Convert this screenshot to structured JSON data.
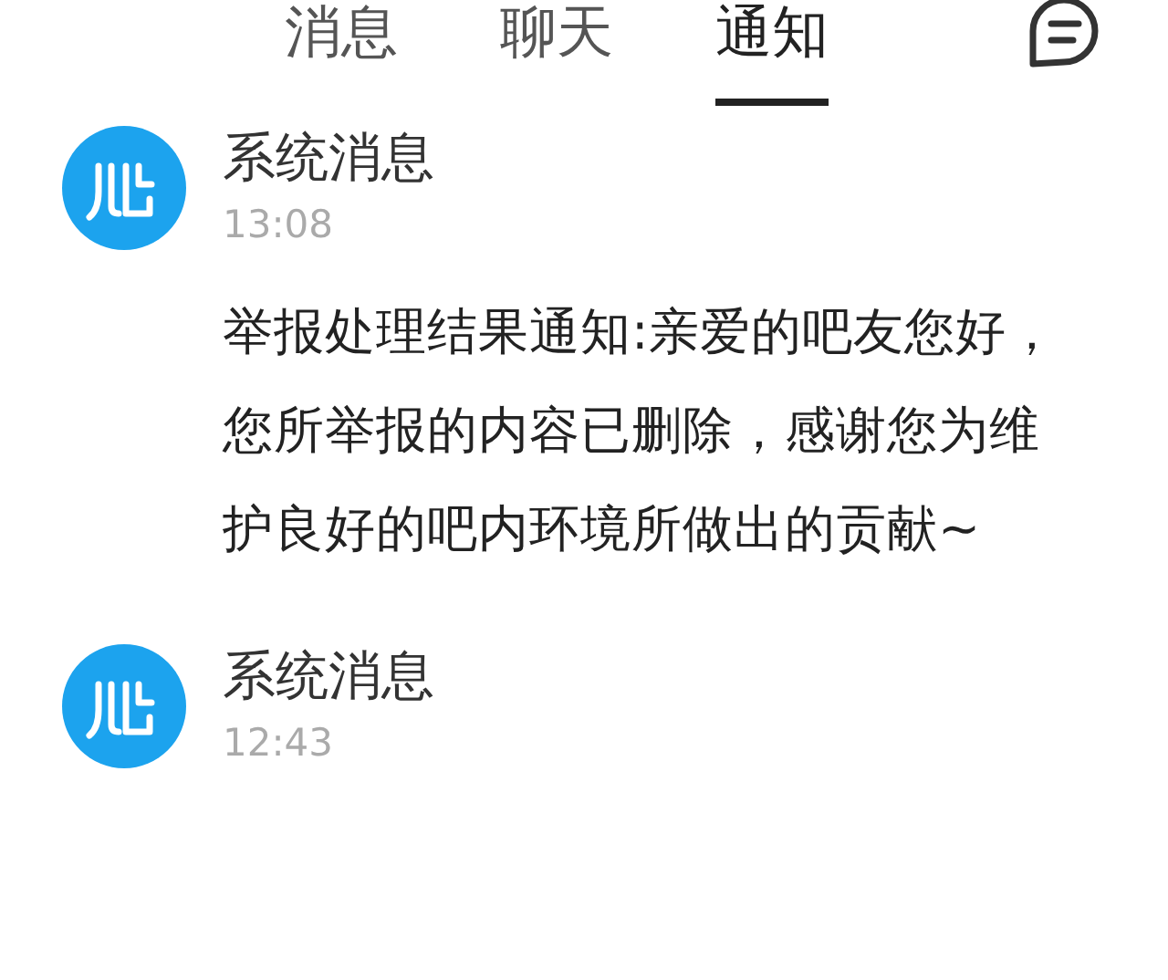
{
  "tabs": [
    {
      "label": "消息",
      "selected": false
    },
    {
      "label": "聊天",
      "selected": false
    },
    {
      "label": "通知",
      "selected": true
    }
  ],
  "messages": [
    {
      "sender": "系统消息",
      "time": "13:08",
      "body": "举报处理结果通知:亲爱的吧友您好，您所举报的内容已删除，感谢您为维护良好的吧内环境所做出的贡献~"
    },
    {
      "sender": "系统消息",
      "time": "12:43"
    }
  ]
}
